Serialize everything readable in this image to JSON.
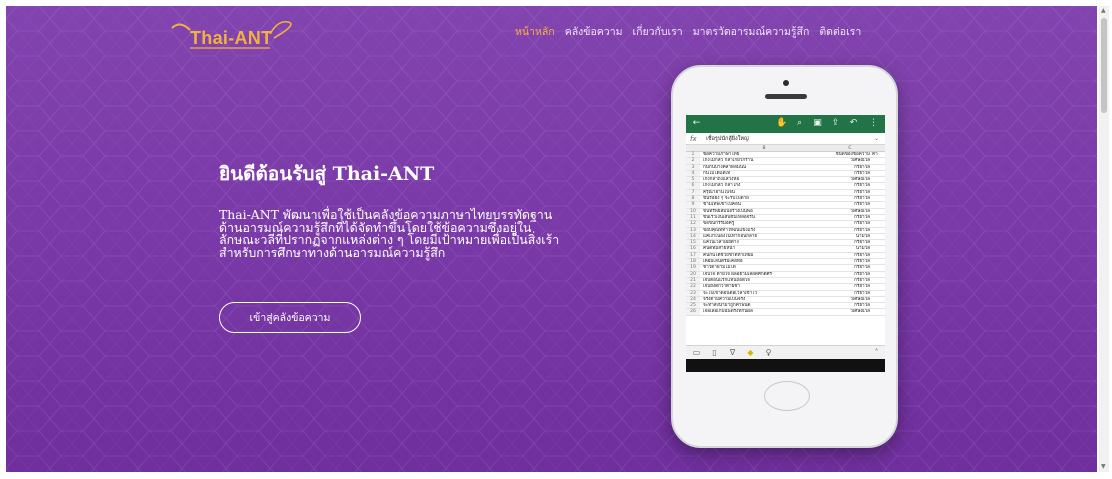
{
  "brand": {
    "logo_text": "Thai-ANT",
    "accent": "#f3b23e",
    "background": "#7a3aa8"
  },
  "nav": {
    "items": [
      {
        "label": "หน้าหลัก",
        "active": true
      },
      {
        "label": "คลังข้อความ",
        "active": false
      },
      {
        "label": "เกี่ยวกับเรา",
        "active": false
      },
      {
        "label": "มาตรวัดอารมณ์ความรู้สึก",
        "active": false
      },
      {
        "label": "ติดต่อเรา",
        "active": false
      }
    ]
  },
  "hero": {
    "title": "ยินดีต้อนรับสู่ Thai-ANT",
    "description": "Thai-ANT พัฒนาเพื่อใช้เป็นคลังข้อความภาษาไทยบรรทัดฐานด้านอารมณ์ความรู้สึกที่ได้จัดทำขึ้นโดยใช้ข้อความซึ่งอยู่ในลักษณะวลีที่ปรากฏจากแหล่งต่าง ๆ โดยมีเป้าหมายเพื่อเป็นสิ่งเร้าสำหรับการศึกษาทางด้านอารมณ์ความรู้สึก",
    "cta_label": "เข้าสู่คลังข้อความ"
  },
  "spreadsheet": {
    "formula_label": "fx",
    "formula_value": "เชื่อรูปนักสู้ยิ่งใหญ่",
    "column_headers": [
      "B",
      "C"
    ],
    "header_row": {
      "a": "ข้อความภาษาไทย",
      "c": "ชนิดของข้อความ",
      "d": "ค่า"
    },
    "rows": [
      {
        "n": "2",
        "a": "เก่งไม่กลัว กล้าเกี่ยวกร้าน",
        "c": "วิเศษณ์วลี"
      },
      {
        "n": "3",
        "a": "กินกันบางคลาดลืมนน",
        "c": "กริยาวลี"
      },
      {
        "n": "4",
        "a": "กินไม่ได้แต่เท",
        "c": "กริยาวลี"
      },
      {
        "n": "5",
        "a": "เก่งกล้าถึงแสวงหอ",
        "c": "วิเศษณ์วลี"
      },
      {
        "n": "6",
        "a": "เก่งไม่กลัว กล้าโกง",
        "c": "กริยาวลี"
      },
      {
        "n": "7",
        "a": "ครุณาอ่านไปจน",
        "c": "กริยาวลี"
      },
      {
        "n": "8",
        "a": "ขันรอยิ่ง ๆ จะรีบไปตาย",
        "c": "กริยาวลี"
      },
      {
        "n": "9",
        "a": "ข้ามเทพเข้าไปคอน",
        "c": "กริยาวลี"
      },
      {
        "n": "10",
        "a": "ขึ้นทรัพย์สมบอร่างเป็นพอ",
        "c": "วิเศษณ์วลี"
      },
      {
        "n": "11",
        "a": "ขันเร็วเงินเส้นขับเหลือจริน",
        "c": "กริยาวลี"
      },
      {
        "n": "12",
        "a": "ขอขนกรรมอัครู",
        "c": "กริยาวลี"
      },
      {
        "n": "13",
        "a": "ขอบคุณที่ทำให้ฉันแข็งแรง",
        "c": "กริยาวลี"
      },
      {
        "n": "14",
        "a": "แค่เงาเนื่องไปเท่าก่อนกลาย",
        "c": "นามวลี"
      },
      {
        "n": "15",
        "a": "แค่ในเวลาเผยต่าง",
        "c": "กริยาวลี"
      },
      {
        "n": "16",
        "a": "คนดีที่มีสายหน้า",
        "c": "นามวลี"
      },
      {
        "n": "17",
        "a": "คนกันได้ช่วยชาติทำเทียม",
        "c": "กริยาวลี"
      },
      {
        "n": "18",
        "a": "เคอมเล่นตรีมเคอท่อ",
        "c": "กริยาวลี"
      },
      {
        "n": "19",
        "a": "ชาวิดายามไม่ได้",
        "c": "กริยาวลี"
      },
      {
        "n": "20",
        "a": "เจ็บใจ ตายใจ ผลอยามเลือดศักดิ์ศรี",
        "c": "กริยาวลี"
      },
      {
        "n": "21",
        "a": "เจ็บตอนแรกแทนถอดใจ",
        "c": "กริยาวลี"
      },
      {
        "n": "22",
        "a": "เจ็บยังดีกว่าด้ายชา",
        "c": "กริยาวลี"
      },
      {
        "n": "23",
        "a": "จะไปเขาดอนต่อเวลาเข้าไว้",
        "c": "กริยาวลี"
      },
      {
        "n": "24",
        "a": "จริงตามความเป็นจริง",
        "c": "วิเศษณ์วลี"
      },
      {
        "n": "25",
        "a": "จะทำสิ่งนำมาถูกคำพนด",
        "c": "กริยาวลี"
      },
      {
        "n": "26",
        "a": "เจอเลอเก็บฉันตรงที่กันผล",
        "c": "วิเศษณ์วลี"
      }
    ]
  },
  "icons": {
    "back": "arrow-left-icon",
    "touch": "touch-icon",
    "search": "search-icon",
    "save": "save-icon",
    "share": "share-icon",
    "undo": "undo-icon",
    "more": "more-icon",
    "fill": "fill-color-icon",
    "filter": "filter-icon",
    "lightbulb": "lightbulb-icon"
  }
}
